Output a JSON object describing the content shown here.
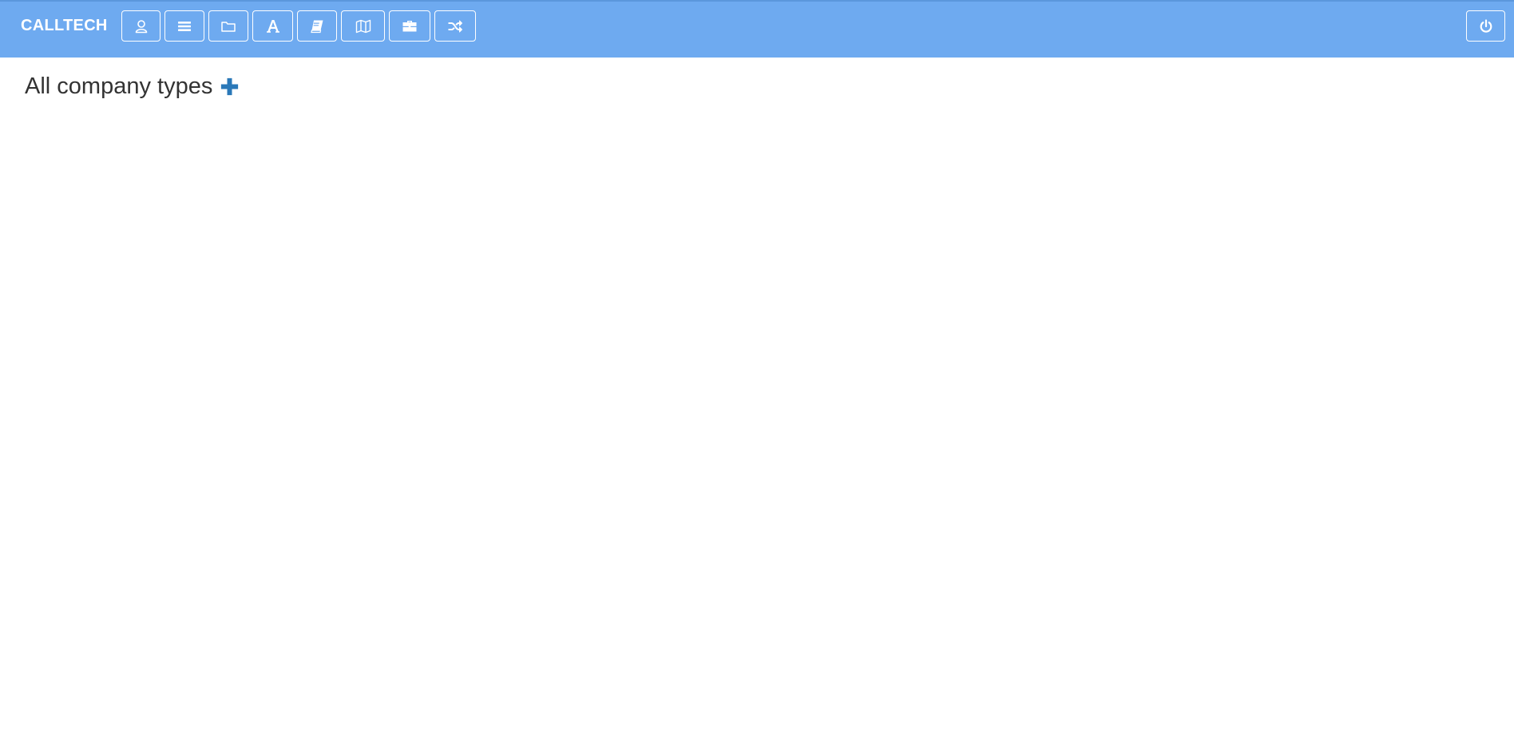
{
  "app": {
    "brand": "CALLTECH"
  },
  "navbar": {
    "buttons": [
      {
        "icon": "user-icon"
      },
      {
        "icon": "menu-icon"
      },
      {
        "icon": "folder-icon"
      },
      {
        "icon": "font-icon"
      },
      {
        "icon": "book-icon"
      },
      {
        "icon": "map-icon"
      },
      {
        "icon": "briefcase-icon"
      },
      {
        "icon": "shuffle-icon"
      }
    ],
    "power_icon": "power-icon"
  },
  "main": {
    "title": "All company types",
    "add_icon": "plus-icon"
  },
  "colors": {
    "navbar_bg": "#6eaaf0",
    "title_text": "#333333",
    "accent": "#2a78b8"
  }
}
